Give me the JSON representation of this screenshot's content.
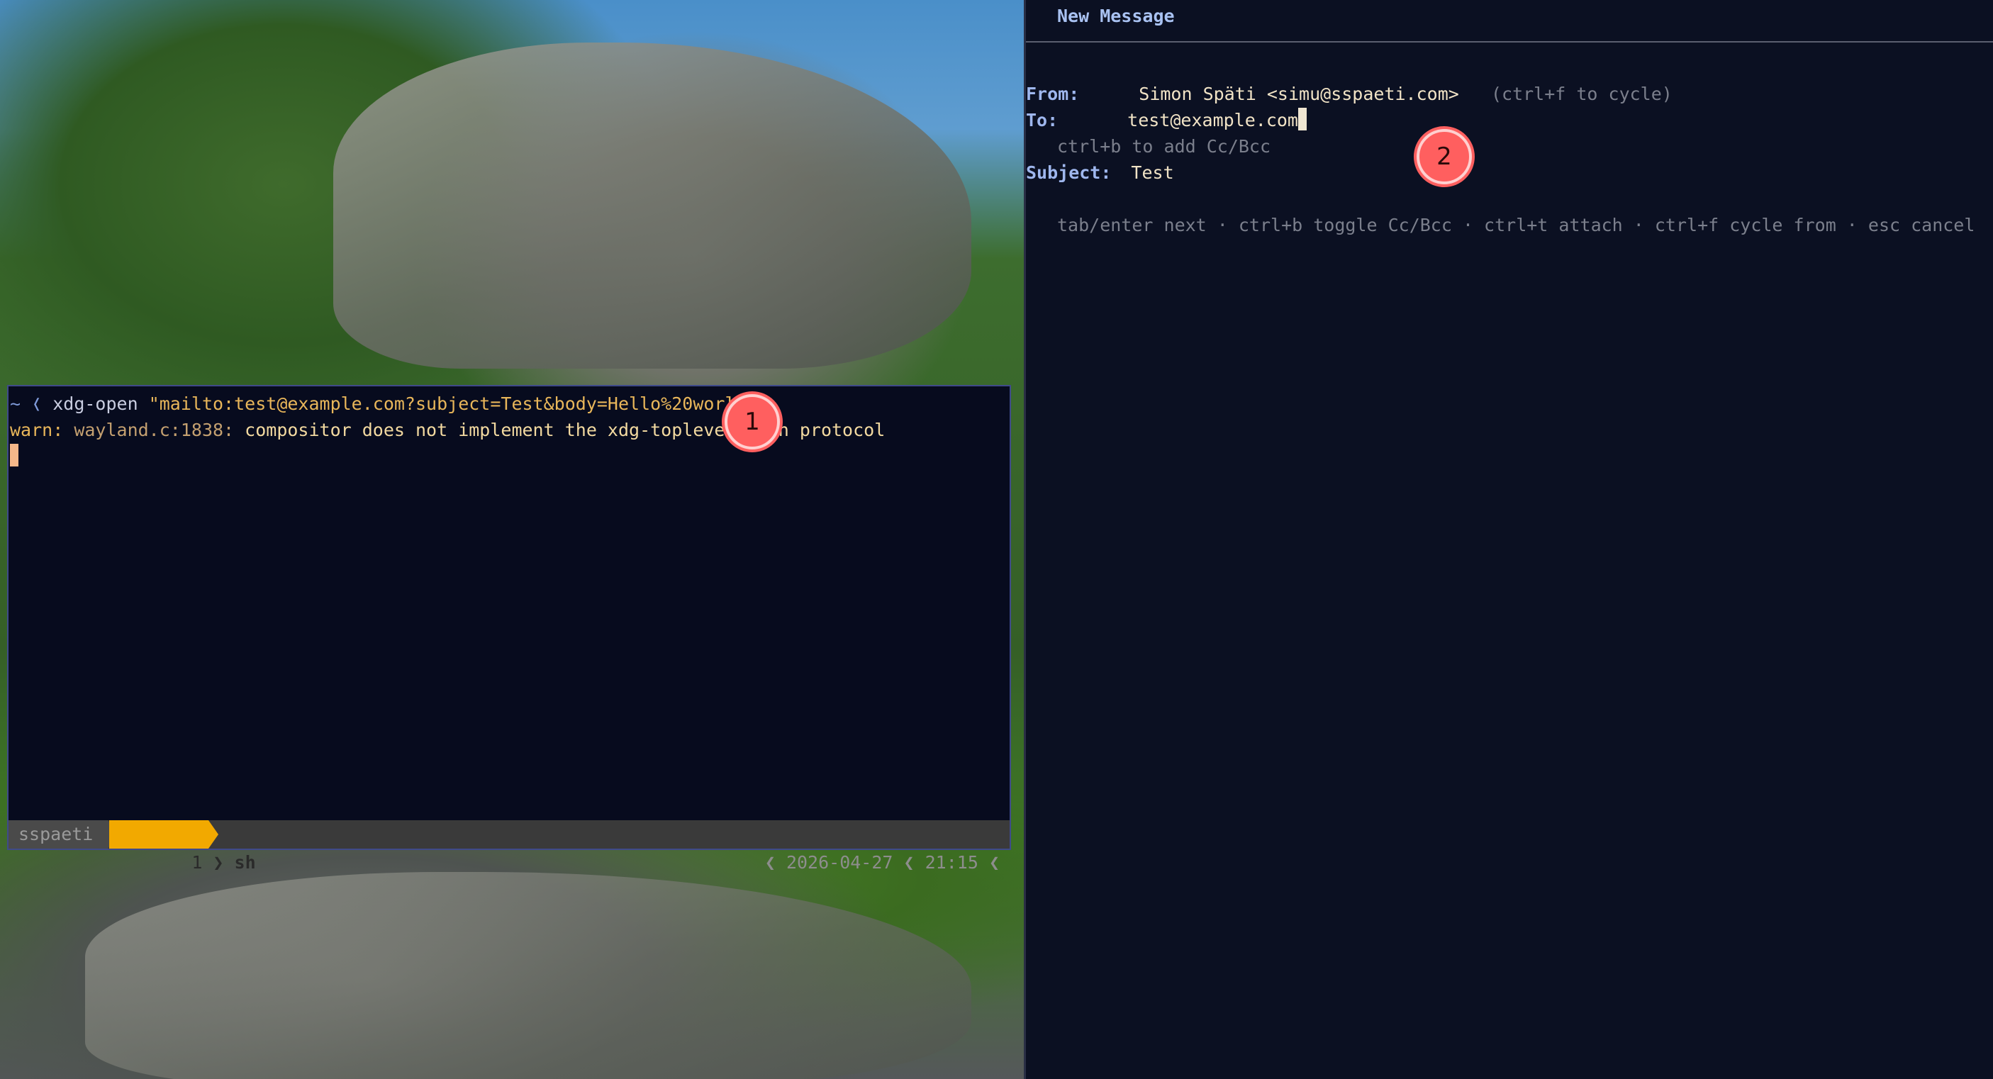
{
  "terminal": {
    "prompt_symbol": "~ ❬",
    "command": "xdg-open",
    "command_arg": "\"mailto:test@example.com?subject=Test&body=Hello%20world\"",
    "warn_label": "warn:",
    "warn_source": "wayland.c:1838:",
    "warn_message": "compositor does not implement the xdg-toplevel-icon protocol",
    "statusbar": {
      "session": "sspaeti",
      "window_index": "1",
      "window_name": "sh",
      "date": "2026-04-27",
      "time": "21:15"
    }
  },
  "compose": {
    "title": "New Message",
    "from_label": "From:",
    "from_value": "Simon Späti <simu@sspaeti.com>",
    "from_hint": "(ctrl+f to cycle)",
    "to_label": "To:",
    "to_value": "test@example.com",
    "cc_hint": "ctrl+b to add Cc/Bcc",
    "subject_label": "Subject:",
    "subject_value": "Test",
    "keys_hint": "tab/enter next · ctrl+b toggle Cc/Bcc · ctrl+t attach · ctrl+f cycle from · esc cancel"
  },
  "markers": [
    "1",
    "2"
  ],
  "colors": {
    "marker": "#ff5f5f",
    "status_accent": "#f2a900",
    "terminal_bg": "#070b1e"
  }
}
